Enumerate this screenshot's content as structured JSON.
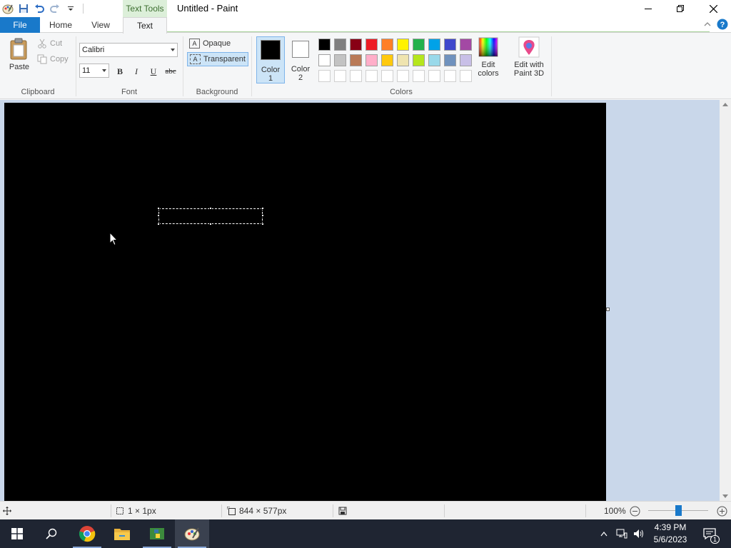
{
  "window": {
    "title": "Untitled - Paint",
    "context_tab_group": "Text Tools"
  },
  "tabs": {
    "file": "File",
    "home": "Home",
    "view": "View",
    "text": "Text"
  },
  "clipboard": {
    "paste": "Paste",
    "cut": "Cut",
    "copy": "Copy",
    "label": "Clipboard"
  },
  "font": {
    "family": "Calibri",
    "size": "11",
    "bold": "B",
    "italic": "I",
    "underline": "U",
    "strikethrough": "abc",
    "label": "Font"
  },
  "background": {
    "opaque": "Opaque",
    "transparent": "Transparent",
    "label": "Background",
    "selected": "Transparent"
  },
  "colors": {
    "color1_label_line1": "Color",
    "color1_label_line2": "1",
    "color1_value": "#000000",
    "color2_label_line1": "Color",
    "color2_label_line2": "2",
    "color2_value": "#ffffff",
    "label": "Colors",
    "edit_colors_line1": "Edit",
    "edit_colors_line2": "colors",
    "edit_3d_line1": "Edit with",
    "edit_3d_line2": "Paint 3D",
    "palette_row1": [
      "#000000",
      "#7f7f7f",
      "#880015",
      "#ed1c24",
      "#ff7f27",
      "#fff200",
      "#22b14c",
      "#00a2e8",
      "#3f48cc",
      "#a349a4"
    ],
    "palette_row2": [
      "#ffffff",
      "#c3c3c3",
      "#b97a57",
      "#ffaec9",
      "#ffc90e",
      "#efe4b0",
      "#b5e61d",
      "#99d9ea",
      "#7092be",
      "#c8bfe7"
    ],
    "palette_row3": [
      "",
      "",
      "",
      "",
      "",
      "",
      "",
      "",
      "",
      ""
    ]
  },
  "canvas": {
    "background": "#000000"
  },
  "status": {
    "selection_size": "1 × 1px",
    "image_size": "844 × 577px",
    "zoom": "100%"
  },
  "taskbar": {
    "time": "4:39 PM",
    "date": "5/6/2023",
    "notifications": "1"
  }
}
